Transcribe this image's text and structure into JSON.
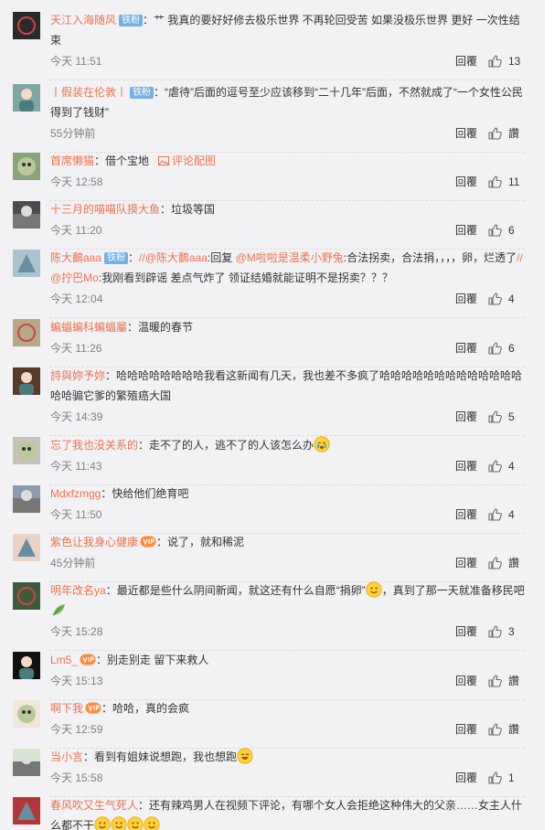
{
  "comments": [
    {
      "user": "天江入海随风",
      "badge": "铁粉",
      "vip": false,
      "segs": [
        {
          "t": "：艹 我真的要好好修去极乐世界 不再轮回受苦 如果没极乐世界 更好 一次性结束"
        }
      ],
      "time": "今天 11:51",
      "reply": "回覆",
      "likes": "13",
      "av": "#2a2a2a"
    },
    {
      "user": "丨假装在伦敦丨",
      "badge": "铁粉",
      "vip": false,
      "segs": [
        {
          "t": "：“虐待”后面的逗号至少应该移到“二十几年”后面，不然就成了“一个女性公民得到了钱财”"
        }
      ],
      "time": "55分钟前",
      "reply": "回覆",
      "likes": "讚",
      "av": "#7fa6a0"
    },
    {
      "user": "首席懒猫",
      "badge": null,
      "vip": false,
      "segs": [
        {
          "t": "：借个宝地"
        }
      ],
      "pic": "评论配图",
      "time": "今天 12:58",
      "reply": "回覆",
      "likes": "11",
      "av": "#8aa37a"
    },
    {
      "user": "十三月的喵喵队摸大鱼",
      "badge": null,
      "vip": false,
      "segs": [
        {
          "t": "：垃圾等国"
        }
      ],
      "time": "今天 11:20",
      "reply": "回覆",
      "likes": "6",
      "av": "#4b4b4b"
    },
    {
      "user": "陈大鷭aaa",
      "badge": "铁粉",
      "vip": false,
      "segs": [
        {
          "t": "："
        },
        {
          "t": "//@陈大鷭aaa",
          "c": "link"
        },
        {
          "t": ":回复 "
        },
        {
          "t": "@M啦啦是温柔小野兔",
          "c": "link"
        },
        {
          "t": ":合法拐卖，合法捐，，，，卵，烂透了"
        },
        {
          "t": "//@拧巴Mo",
          "c": "link"
        },
        {
          "t": ":我刚看到辟谣 差点气炸了 领证结婚就能证明不是拐卖？？？"
        }
      ],
      "time": "今天 12:04",
      "reply": "回覆",
      "likes": "4",
      "av": "#a9c4cf"
    },
    {
      "user": "蝙蝠蝙科蝙蝠屬",
      "badge": null,
      "vip": false,
      "segs": [
        {
          "t": "：温暖的春节"
        }
      ],
      "time": "今天 11:26",
      "reply": "回覆",
      "likes": "6",
      "av": "#b8a88a"
    },
    {
      "user": "詩與妳予妳",
      "badge": null,
      "vip": false,
      "segs": [
        {
          "t": "：哈哈哈哈哈哈哈哈我看这新闻有几天，我也差不多疯了哈哈哈哈哈哈哈哈哈哈哈哈哈哈哈骟它爹的繁殖癌大国"
        }
      ],
      "time": "今天 14:39",
      "reply": "回覆",
      "likes": "5",
      "av": "#5a3b2a"
    },
    {
      "user": "忘了我也没关系的",
      "badge": null,
      "vip": false,
      "segs": [
        {
          "t": "：走不了的人，逃不了的人该怎么办"
        },
        {
          "e": "cry"
        }
      ],
      "time": "今天 11:43",
      "reply": "回覆",
      "likes": "4",
      "av": "#c7c3b6"
    },
    {
      "user": "Mdxfzmgg",
      "badge": null,
      "vip": false,
      "segs": [
        {
          "t": "：快给他们绝育吧"
        }
      ],
      "time": "今天 11:50",
      "reply": "回覆",
      "likes": "4",
      "av": "#8c9bb0"
    },
    {
      "user": "紫色让我身心健康",
      "badge": null,
      "vip": true,
      "segs": [
        {
          "t": "：说了，就和稀泥"
        }
      ],
      "time": "45分钟前",
      "reply": "回覆",
      "likes": "讚",
      "av": "#e9d3c7"
    },
    {
      "user": "明年改名ya",
      "badge": null,
      "vip": false,
      "segs": [
        {
          "t": "：最近都是些什么阴间新闻，就这还有什么自愿“捐卵”"
        },
        {
          "e": "smile"
        },
        {
          "t": "，真到了那一天就准备移民吧"
        },
        {
          "e": "leaf"
        }
      ],
      "time": "今天 15:28",
      "reply": "回覆",
      "likes": "3",
      "av": "#3c5a3c"
    },
    {
      "user": "Lm5_",
      "badge": null,
      "vip": true,
      "segs": [
        {
          "t": "：别走别走 留下来救人"
        }
      ],
      "time": "今天 15:13",
      "reply": "回覆",
      "likes": "讚",
      "av": "#111111"
    },
    {
      "user": "啊下我",
      "badge": null,
      "vip": true,
      "segs": [
        {
          "t": "：哈哈，真的会疯"
        }
      ],
      "time": "今天 12:59",
      "reply": "回覆",
      "likes": "讚",
      "av": "#f0e6da"
    },
    {
      "user": "当小言",
      "badge": null,
      "vip": false,
      "segs": [
        {
          "t": "：看到有姐妹说想跑，我也想跑"
        },
        {
          "e": "laugh"
        }
      ],
      "time": "今天 15:58",
      "reply": "回覆",
      "likes": "1",
      "av": "#d9e3d1"
    },
    {
      "user": "春风吹又生气死人",
      "badge": null,
      "vip": false,
      "segs": [
        {
          "t": "：还有辣鸡男人在视频下评论，有哪个女人会拒绝这种伟大的父亲……女主人什么都不干"
        },
        {
          "e": "smile"
        },
        {
          "e": "smile"
        },
        {
          "e": "smile"
        },
        {
          "e": "smile"
        }
      ],
      "time": "",
      "reply": "",
      "likes": "",
      "av": "#b2373a"
    }
  ]
}
